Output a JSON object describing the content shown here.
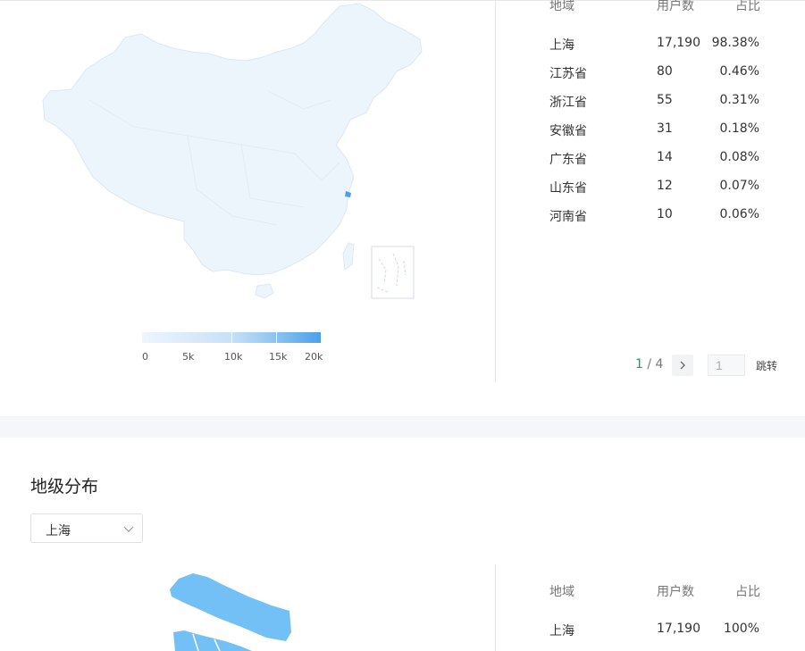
{
  "province_table": {
    "headers": [
      "地域",
      "用户数",
      "占比"
    ],
    "rows": [
      {
        "region": "上海",
        "users": "17,190",
        "ratio": "98.38%"
      },
      {
        "region": "江苏省",
        "users": "80",
        "ratio": "0.46%"
      },
      {
        "region": "浙江省",
        "users": "55",
        "ratio": "0.31%"
      },
      {
        "region": "安徽省",
        "users": "31",
        "ratio": "0.18%"
      },
      {
        "region": "广东省",
        "users": "14",
        "ratio": "0.08%"
      },
      {
        "region": "山东省",
        "users": "12",
        "ratio": "0.07%"
      },
      {
        "region": "河南省",
        "users": "10",
        "ratio": "0.06%"
      }
    ]
  },
  "legend": {
    "labels": [
      "0",
      "5k",
      "10k",
      "15k",
      "20k"
    ],
    "colors": [
      "#eef5fd",
      "#c7e1f8",
      "#8cc3f0",
      "#4aa1e8"
    ]
  },
  "pagination": {
    "current": "1",
    "separator": " / ",
    "total": "4",
    "next_icon": "chevron-right-icon",
    "input_value": "1",
    "jump_label": "跳转"
  },
  "city_section": {
    "title": "地级分布",
    "selected_region": "上海",
    "dropdown_icon": "chevron-down-icon",
    "headers": [
      "地域",
      "用户数",
      "占比"
    ],
    "rows": [
      {
        "region": "上海",
        "users": "17,190",
        "ratio": "100%"
      }
    ]
  },
  "colors": {
    "map_fill": "#ecf4fc",
    "highlight": "#4aa1e8",
    "shanghai_fill": "#73c0f7",
    "pager_current": "#19a15f"
  }
}
